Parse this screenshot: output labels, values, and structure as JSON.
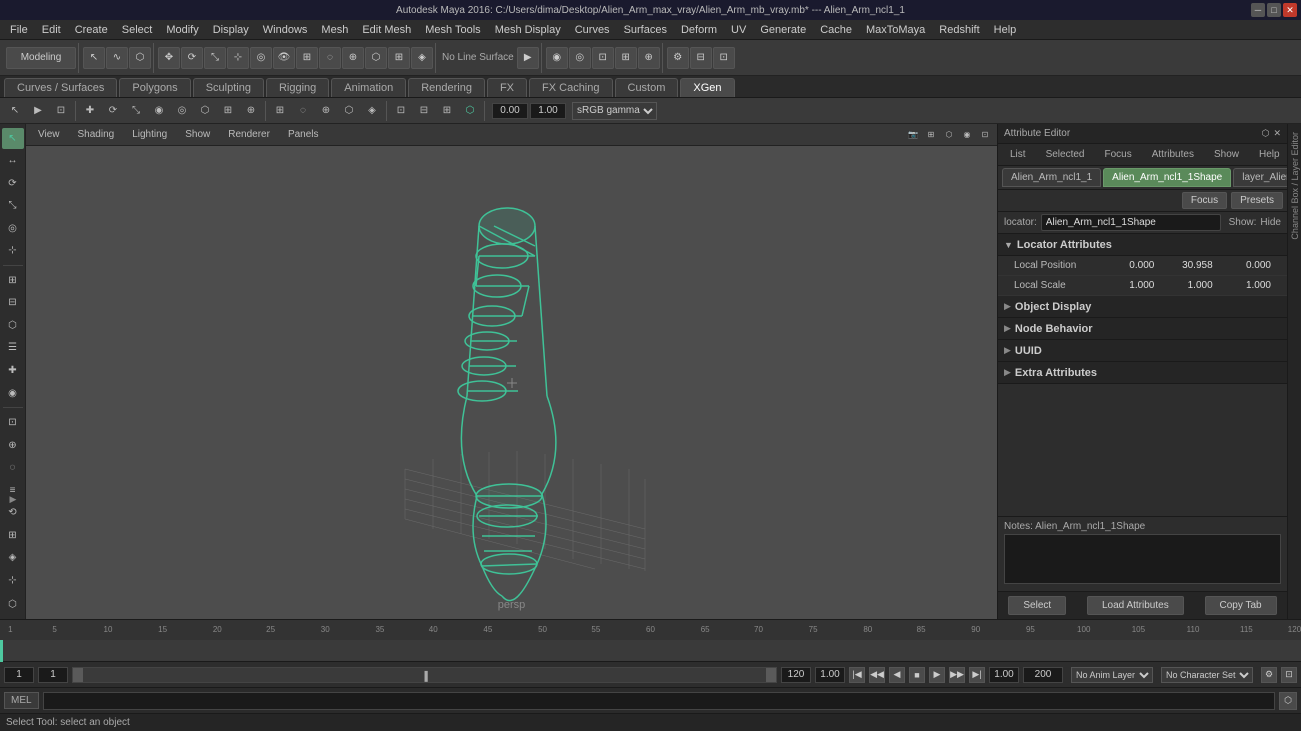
{
  "titlebar": {
    "title": "Autodesk Maya 2016: C:/Users/dima/Desktop/Alien_Arm_max_vray/Alien_Arm_mb_vray.mb* --- Alien_Arm_ncl1_1",
    "minimize": "─",
    "maximize": "□",
    "close": "✕"
  },
  "menubar": {
    "items": [
      "File",
      "Edit",
      "Create",
      "Select",
      "Modify",
      "Display",
      "Windows",
      "Mesh",
      "Edit Mesh",
      "Mesh Tools",
      "Mesh Display",
      "Curves",
      "Surfaces",
      "Deform",
      "UV",
      "Generate",
      "Cache",
      "MaxToMaya",
      "Redshift",
      "Help"
    ]
  },
  "workspace_dropdown": "Modeling",
  "workspace_tabs": [
    {
      "label": "Curves / Surfaces"
    },
    {
      "label": "Polygons"
    },
    {
      "label": "Sculpting"
    },
    {
      "label": "Rigging"
    },
    {
      "label": "Animation"
    },
    {
      "label": "Rendering"
    },
    {
      "label": "FX"
    },
    {
      "label": "FX Caching"
    },
    {
      "label": "Custom"
    },
    {
      "label": "XGen",
      "active": true
    }
  ],
  "toolbar2_items": [
    "S",
    "→",
    "⟲",
    "⟳",
    "↔",
    "↕",
    "⟲",
    "⌖",
    "⊡",
    "☰",
    "≡"
  ],
  "viewport": {
    "tabs": [
      "View",
      "Shading",
      "Lighting",
      "Show",
      "Renderer",
      "Panels"
    ],
    "label": "persp"
  },
  "color_space": "sRGB gamma",
  "values": {
    "v1": "0.00",
    "v2": "1.00"
  },
  "attribute_editor": {
    "title": "Attribute Editor",
    "tabs": [
      "List",
      "Selected",
      "Focus",
      "Attributes",
      "Show",
      "Help"
    ],
    "node_tabs": [
      {
        "label": "Alien_Arm_ncl1_1"
      },
      {
        "label": "Alien_Arm_ncl1_1Shape",
        "active": true
      },
      {
        "label": "layer_Alien_Arm"
      }
    ],
    "focus_btn": "Focus",
    "presets_btn": "Presets",
    "show_label": "Show:",
    "hide_label": "Hide",
    "locator_label": "locator:",
    "locator_value": "Alien_Arm_ncl1_1Shape",
    "sections": {
      "locator_attributes": {
        "title": "Locator Attributes",
        "expanded": true,
        "local_position": {
          "label": "Local Position",
          "x": "0.000",
          "y": "30.958",
          "z": "0.000"
        },
        "local_scale": {
          "label": "Local Scale",
          "x": "1.000",
          "y": "1.000",
          "z": "1.000"
        }
      },
      "object_display": {
        "title": "Object Display",
        "expanded": false
      },
      "node_behavior": {
        "title": "Node Behavior",
        "expanded": false
      },
      "uuid": {
        "title": "UUID",
        "expanded": false
      },
      "extra_attributes": {
        "title": "Extra Attributes",
        "expanded": false
      }
    },
    "notes": {
      "label": "Notes: Alien_Arm_ncl1_1Shape",
      "content": ""
    },
    "bottom_btns": [
      "Select",
      "Load Attributes",
      "Copy Tab"
    ]
  },
  "timeline": {
    "start": "1",
    "end": "120",
    "current": "1",
    "range_start": "1",
    "range_end": "120",
    "fps": "200",
    "ticks": [
      "1",
      "5",
      "10",
      "15",
      "20",
      "25",
      "30",
      "35",
      "40",
      "45",
      "50",
      "55",
      "60",
      "65",
      "70",
      "75",
      "80",
      "85",
      "90",
      "95",
      "100",
      "105",
      "110",
      "115",
      "120"
    ],
    "tick_positions": [
      0,
      4,
      8.3,
      12.5,
      16.7,
      20.8,
      25,
      29.2,
      33.3,
      37.5,
      41.7,
      45.8,
      50,
      54.2,
      58.3,
      62.5,
      66.7,
      70.8,
      75,
      79.2,
      83.3,
      87.5,
      91.7,
      95.8,
      100
    ]
  },
  "playback": {
    "current_frame": "1",
    "range_start": "1",
    "range_end": "120",
    "fps_val": "200",
    "anim_layer": "No Anim Layer",
    "char_set": "No Character Set"
  },
  "mel": {
    "label": "MEL",
    "placeholder": ""
  },
  "status": {
    "text": "Select Tool: select an object"
  },
  "channel_box": {
    "label": "Channel Box / Layer Editor"
  }
}
